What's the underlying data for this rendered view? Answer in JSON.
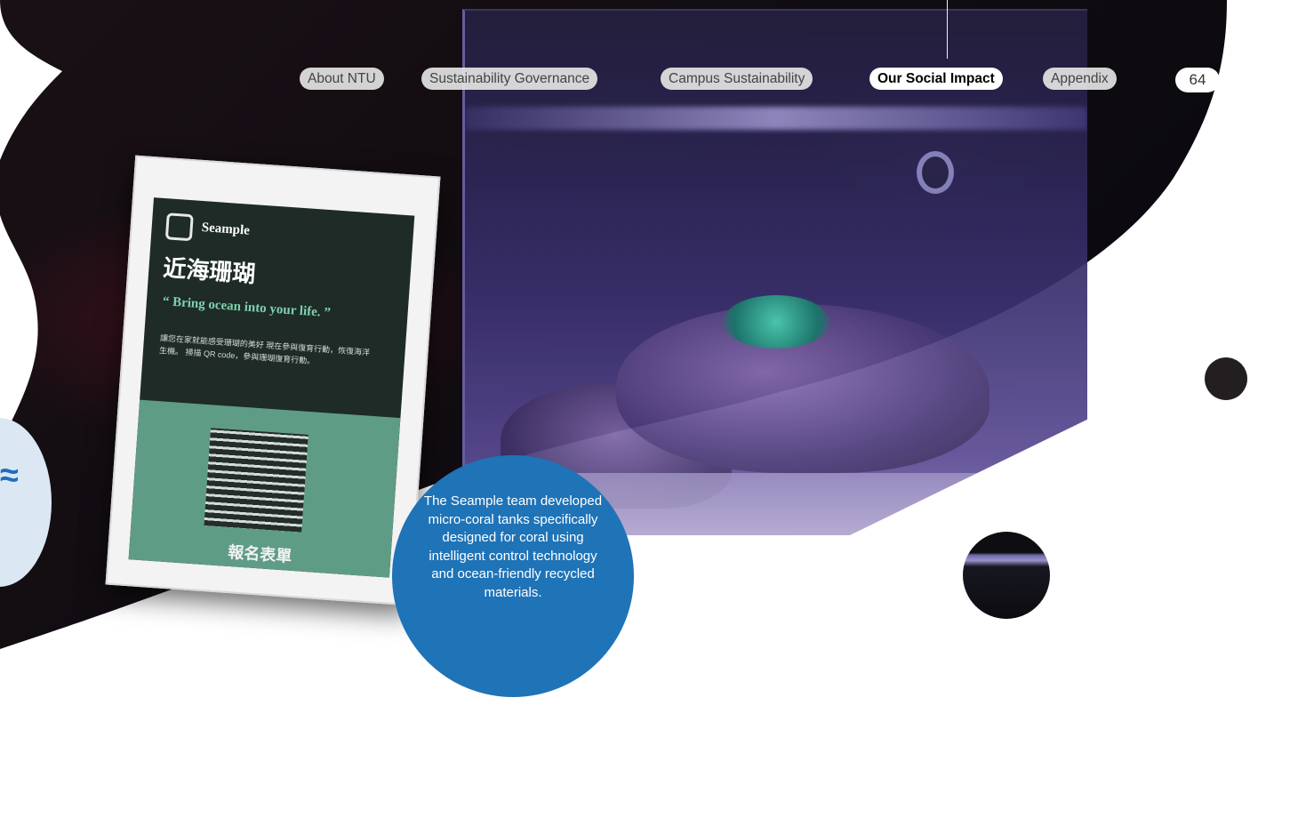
{
  "nav": {
    "tabs": [
      {
        "label": "About NTU",
        "active": false
      },
      {
        "label": "Sustainability Governance",
        "active": false
      },
      {
        "label": "Campus Sustainability",
        "active": false
      },
      {
        "label": "Our Social Impact",
        "active": true
      },
      {
        "label": "Appendix",
        "active": false
      }
    ]
  },
  "page_number": "64",
  "sign": {
    "brand": "Seample",
    "chinese_title": "近海珊瑚",
    "quote": "“ Bring ocean into your life. ”",
    "body": "讓您在家就能感受珊瑚的美好 現在參與復育行動，恢復海洋生機。 掃描 QR code，參與珊瑚復育行動。",
    "signup": "報名表單"
  },
  "caption": "The Seample team developed micro-coral tanks specifically designed for coral using intelligent control technology and ocean-friendly recycled materials.",
  "colors": {
    "caption_bg": "#1f73b7",
    "tab_bg": "#e4e4e4",
    "active_tab_bg": "#ffffff",
    "dark_dot": "#231f20"
  }
}
